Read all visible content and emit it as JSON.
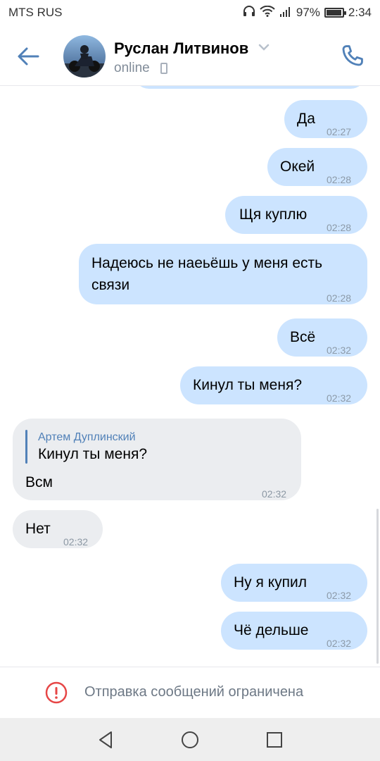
{
  "status_bar": {
    "carrier": "MTS RUS",
    "battery": "97%",
    "battery_level": 0.97,
    "time": "2:34"
  },
  "header": {
    "contact_name": "Руслан Литвинов",
    "status": "online",
    "icons": {
      "back": "back-arrow-icon",
      "call": "phone-icon",
      "chevron": "chevron-down-icon",
      "device": "mobile-phone-icon"
    },
    "accent_color": "#5181b8"
  },
  "messages": [
    {
      "direction": "out",
      "text": "Да",
      "time": "02:27"
    },
    {
      "direction": "out",
      "text": "Окей",
      "time": "02:28"
    },
    {
      "direction": "out",
      "text": "Щя куплю",
      "time": "02:28"
    },
    {
      "direction": "out",
      "text_lines": [
        "Надеюсь не наеьёшь у меня есть",
        "связи"
      ],
      "time": "02:28"
    },
    {
      "direction": "out",
      "text": "Всё",
      "time": "02:32"
    },
    {
      "direction": "out",
      "text": "Кинул ты меня?",
      "time": "02:32"
    },
    {
      "direction": "in",
      "reply": {
        "author": "Артем Дуплинский",
        "text": "Кинул ты меня?"
      },
      "text": "Всм",
      "time": "02:32"
    },
    {
      "direction": "in",
      "text": "Нет",
      "time": "02:32"
    },
    {
      "direction": "out",
      "text": "Ну я купил",
      "time": "02:32"
    },
    {
      "direction": "out",
      "text": "Чё дельше",
      "time": "02:32"
    }
  ],
  "footer": {
    "restriction_text": "Отправка сообщений ограничена",
    "icon": "exclamation-circle-icon",
    "icon_color": "#e64646"
  },
  "colors": {
    "outgoing_bubble": "#cce4ff",
    "incoming_bubble": "#ebedf0"
  },
  "nav_bar": {
    "icons": [
      "nav-back-icon",
      "nav-home-icon",
      "nav-recents-icon"
    ]
  }
}
